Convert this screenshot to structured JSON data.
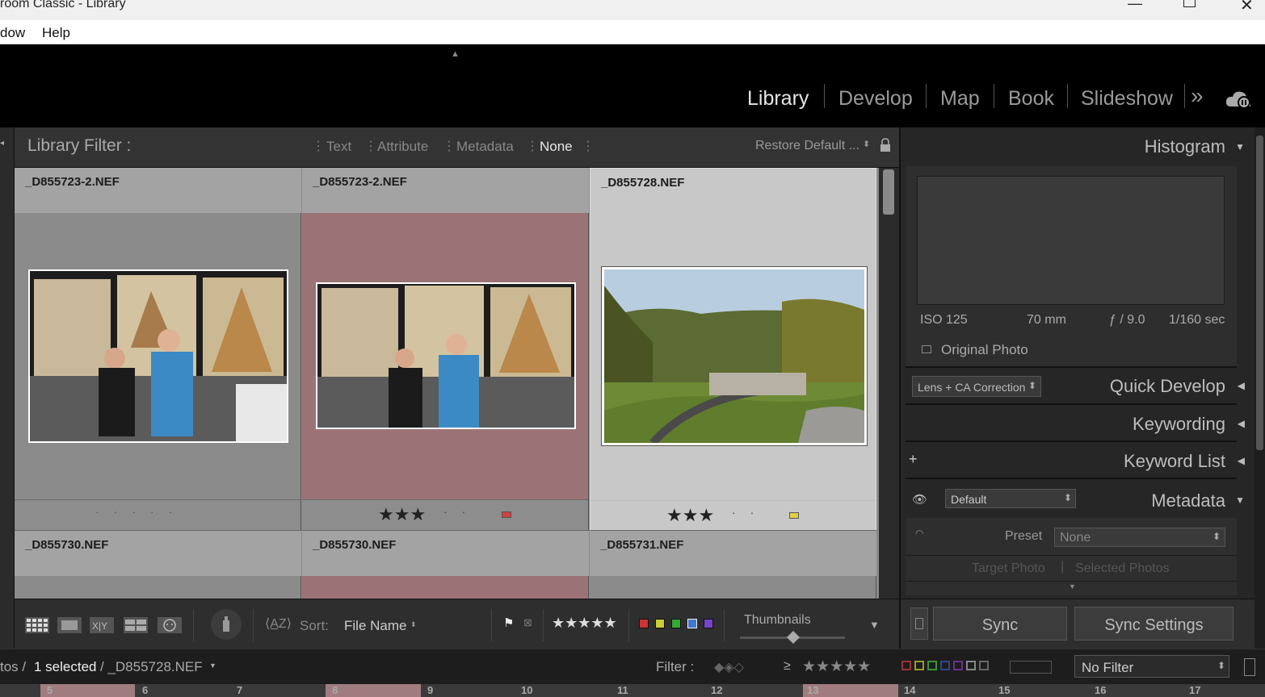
{
  "window": {
    "title": "room Classic - Library",
    "minimize_icon": "minimize-icon",
    "maximize_icon": "maximize-icon",
    "close_icon": "close-icon"
  },
  "menu": {
    "items": [
      "dow",
      "Help"
    ]
  },
  "modules": {
    "items": [
      "Library",
      "Develop",
      "Map",
      "Book",
      "Slideshow"
    ],
    "active": "Library",
    "more_glyph": "»",
    "cloud_icon": "cloud-sync-icon"
  },
  "filter_bar": {
    "title": "Library Filter :",
    "tabs": [
      "Text",
      "Attribute",
      "Metadata",
      "None"
    ],
    "active": "None",
    "preset": "Restore Default ...",
    "lock_icon": "lock-icon"
  },
  "grid": {
    "cells": [
      {
        "filename": "_D855723-2.NEF",
        "stars": 0,
        "label_color": "",
        "selected": false
      },
      {
        "filename": "_D855723-2.NEF",
        "stars": 3,
        "label_color": "#d04040",
        "selected": false
      },
      {
        "filename": "_D855728.NEF",
        "stars": 3,
        "label_color": "#e0d048",
        "selected": true
      },
      {
        "filename": "_D855730.NEF",
        "stars": 0,
        "label_color": "",
        "selected": false
      },
      {
        "filename": "_D855730.NEF",
        "stars": 0,
        "label_color": "",
        "selected": false
      },
      {
        "filename": "_D855731.NEF",
        "stars": 0,
        "label_color": "",
        "selected": false
      }
    ]
  },
  "toolbar": {
    "sort_label": "Sort:",
    "sort_value": "File Name",
    "view_mode_label": "Thumbnails",
    "stars": "★★★★★"
  },
  "histogram": {
    "title": "Histogram",
    "iso": "ISO 125",
    "focal": "70 mm",
    "aperture": "ƒ / 9.0",
    "shutter": "1/160 sec",
    "original_photo": "Original Photo"
  },
  "quick_develop": {
    "title": "Quick Develop",
    "preset": "Lens + CA Correction"
  },
  "keywording": {
    "title": "Keywording"
  },
  "keyword_list": {
    "title": "Keyword List",
    "add": "+"
  },
  "metadata": {
    "title": "Metadata",
    "preset_select": "Default",
    "preset_label": "Preset",
    "preset_value": "None",
    "target_photo": "Target Photo",
    "selected_photos": "Selected Photos"
  },
  "sync": {
    "sync": "Sync",
    "sync_settings": "Sync Settings"
  },
  "filmstrip_bar": {
    "photos_tail": "tos /",
    "selected_count": "1 selected",
    "current_file": "/ _D855728.NEF",
    "filter_label": "Filter :",
    "gte": "≥",
    "rating_stars": "★★★★★",
    "no_filter": "No Filter"
  },
  "filmstrip": {
    "numbers": [
      "5",
      "6",
      "7",
      "8",
      "9",
      "10",
      "11",
      "12",
      "13",
      "14",
      "15",
      "16",
      "17"
    ]
  }
}
